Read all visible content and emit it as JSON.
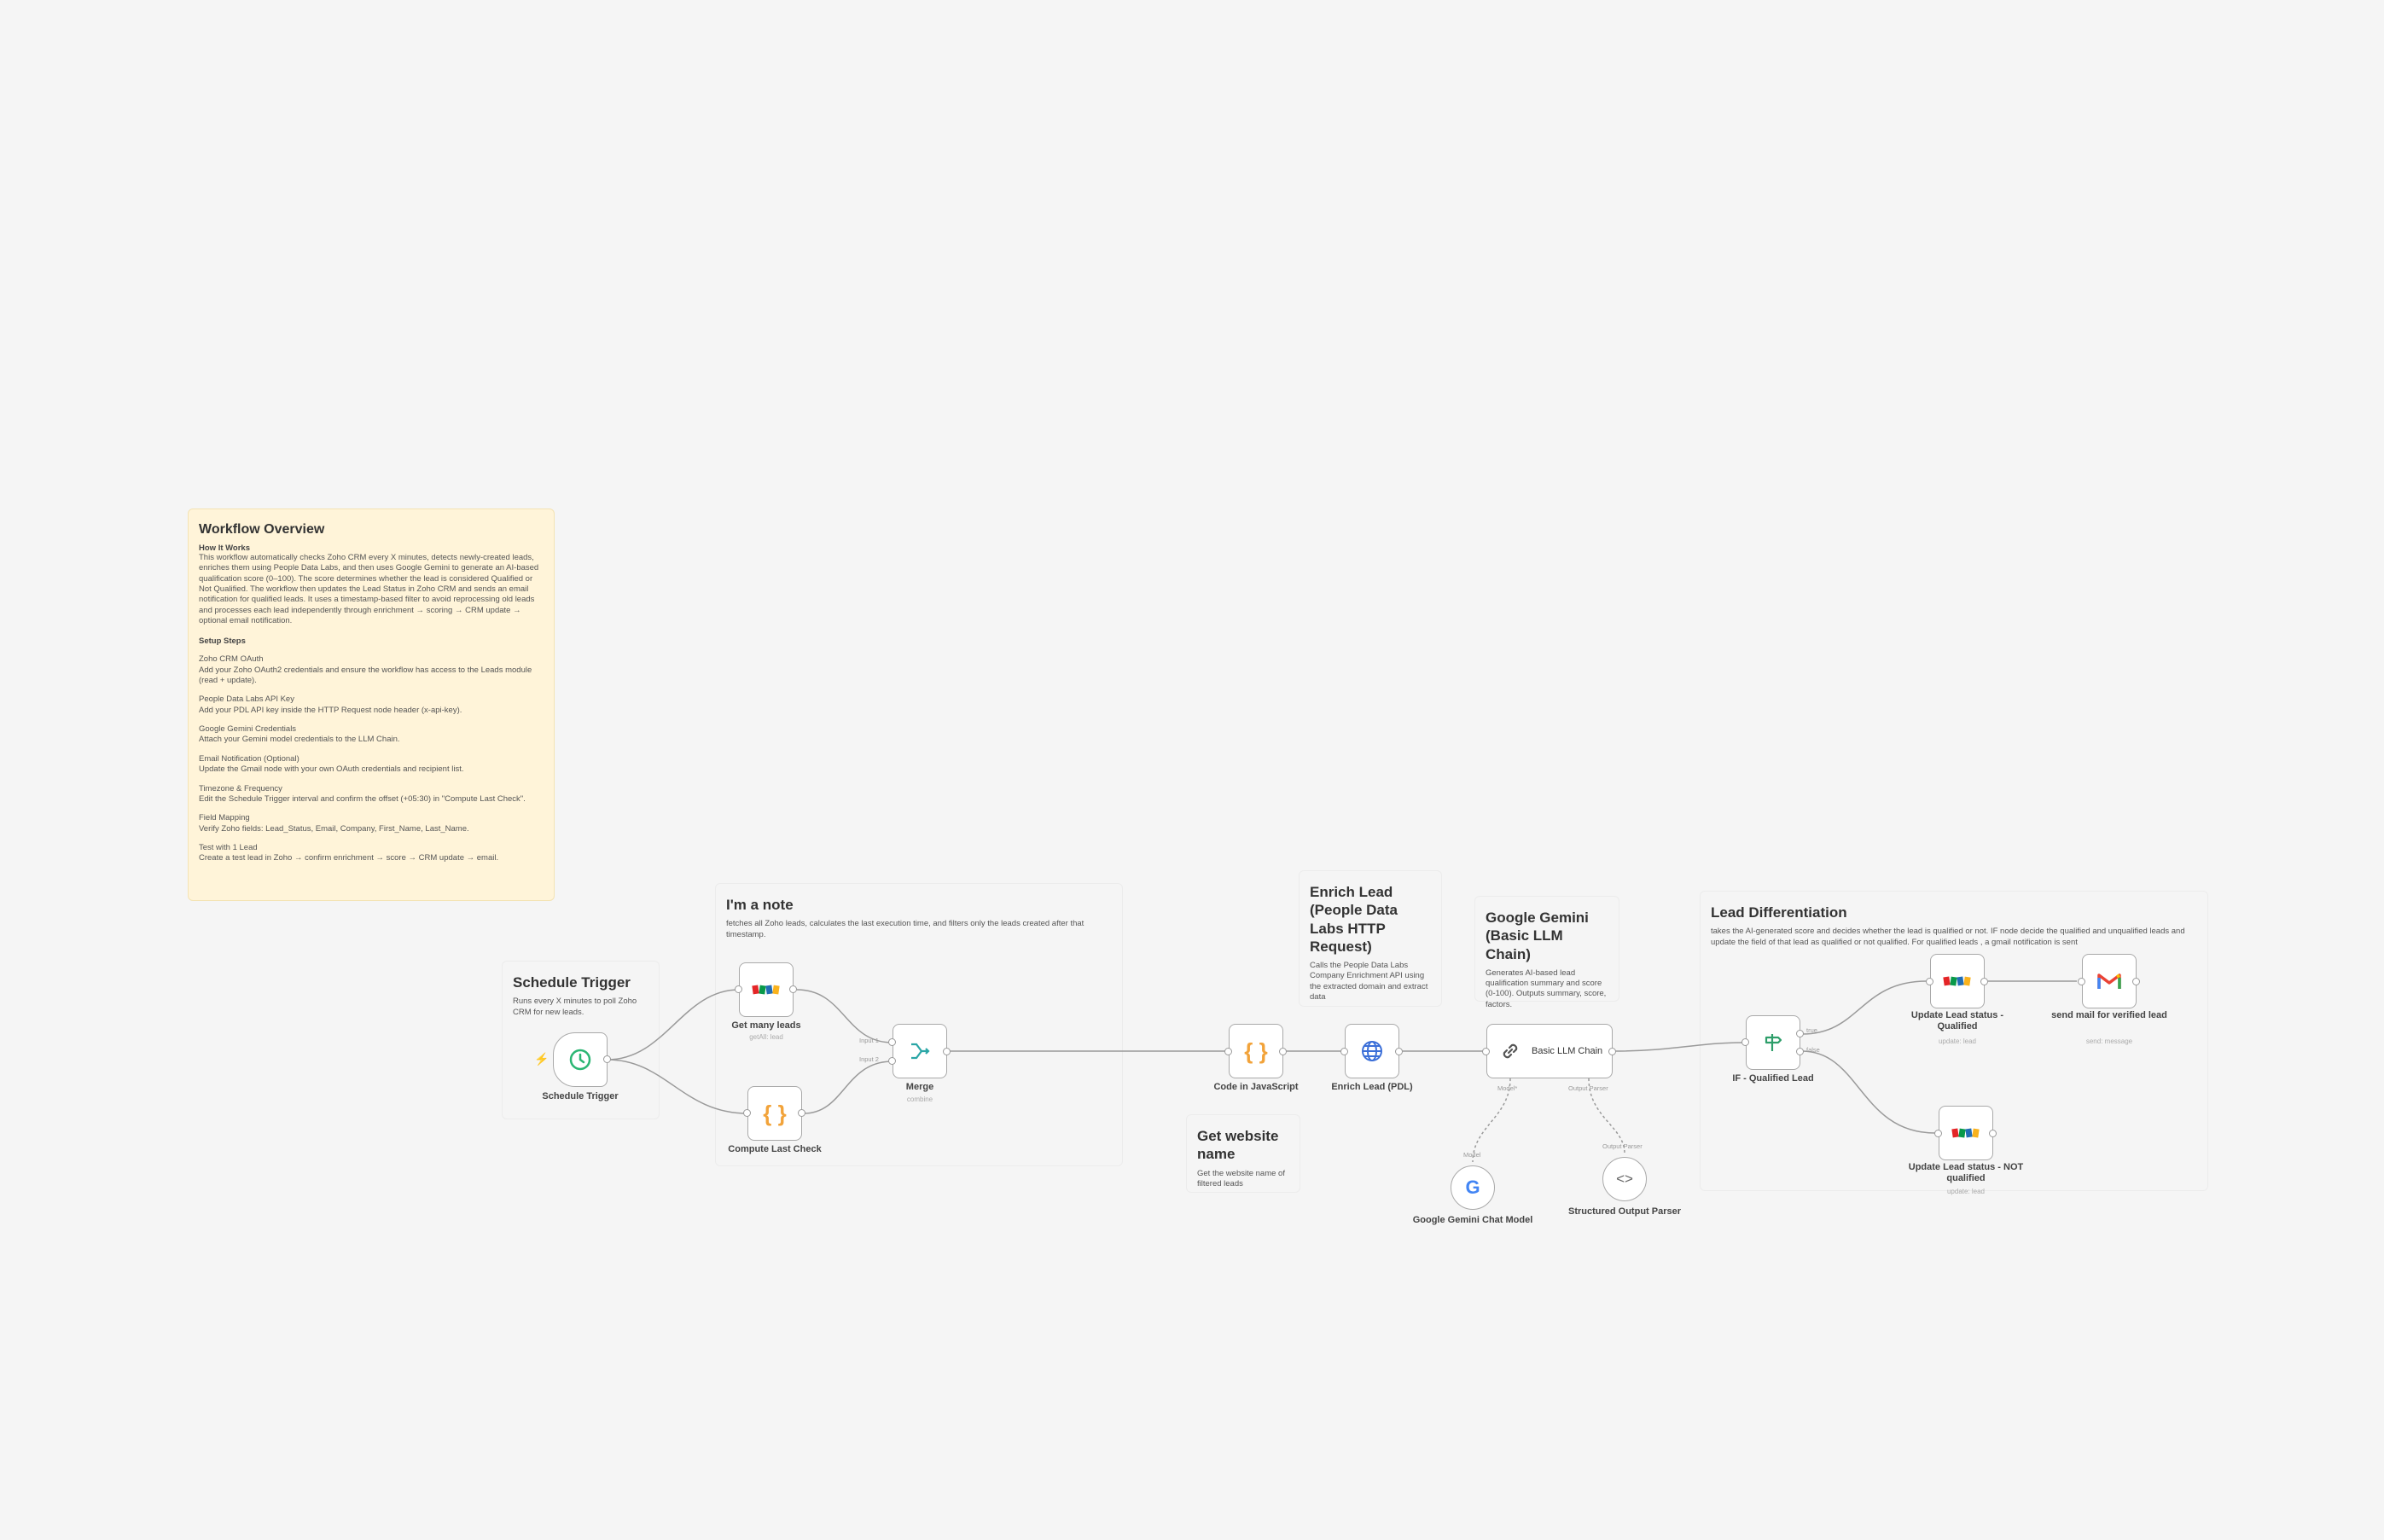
{
  "notes": {
    "overview": {
      "title": "Workflow Overview",
      "how_heading": "How It Works",
      "how_body": "This workflow automatically checks Zoho CRM every X minutes, detects newly-created leads, enriches them using People Data Labs, and then uses Google Gemini to generate an AI-based qualification score (0–100). The score determines whether the lead is considered Qualified or Not Qualified. The workflow then updates the Lead Status in Zoho CRM and sends an email notification for qualified leads. It uses a timestamp-based filter to avoid reprocessing old leads and processes each lead independently through enrichment → scoring → CRM update → optional email notification.",
      "setup_heading": "Setup Steps",
      "steps": [
        {
          "title": "Zoho CRM OAuth",
          "text": "Add your Zoho OAuth2 credentials and ensure the workflow has access to the Leads module (read + update)."
        },
        {
          "title": "People Data Labs API Key",
          "text": "Add your PDL API key inside the HTTP Request node header (x-api-key)."
        },
        {
          "title": "Google Gemini Credentials",
          "text": "Attach your Gemini model credentials to the LLM Chain."
        },
        {
          "title": "Email Notification (Optional)",
          "text": "Update the Gmail node with your own OAuth credentials and recipient list."
        },
        {
          "title": "Timezone & Frequency",
          "text": "Edit the Schedule Trigger interval and confirm the offset (+05:30) in \"Compute Last Check\"."
        },
        {
          "title": "Field Mapping",
          "text": "Verify Zoho fields: Lead_Status, Email, Company, First_Name, Last_Name."
        },
        {
          "title": "Test with 1 Lead",
          "text": "Create a test lead in Zoho → confirm enrichment → score → CRM update → email."
        }
      ]
    },
    "im_a_note": {
      "title": "I'm a note",
      "body": "fetches all Zoho leads, calculates the last execution time, and filters only the leads created after that timestamp."
    },
    "schedule_trigger": {
      "title": "Schedule Trigger",
      "body": "Runs every X minutes to poll Zoho CRM for new leads."
    },
    "enrich_lead": {
      "title": "Enrich Lead (People Data Labs HTTP Request)",
      "body": "Calls the People Data Labs Company Enrichment API using the extracted domain and extract data"
    },
    "google_gemini": {
      "title": "Google Gemini (Basic LLM Chain)",
      "body": "Generates AI-based lead qualification summary and score (0-100). Outputs summary, score, factors."
    },
    "get_website": {
      "title": "Get website name",
      "body": "Get the website name of filtered leads"
    },
    "lead_diff": {
      "title": "Lead Differentiation",
      "body": "takes the AI-generated score and decides whether the lead is qualified or not. IF node decide the qualified and unqualified leads and update the field of that lead as qualified or not qualified. For qualified leads , a gmail notification is sent"
    }
  },
  "nodes": {
    "schedule_trigger": {
      "label": "Schedule Trigger",
      "icon": "clock-icon"
    },
    "get_many_leads": {
      "label": "Get many leads",
      "sub": "getAll: lead",
      "icon": "zoho-icon"
    },
    "compute_last_check": {
      "label": "Compute Last Check",
      "icon": "code-braces-icon"
    },
    "merge": {
      "label": "Merge",
      "sub": "combine",
      "input1": "Input 1",
      "input2": "Input 2",
      "icon": "merge-icon"
    },
    "code_js": {
      "label": "Code in JavaScript",
      "icon": "code-braces-icon"
    },
    "enrich_pdl": {
      "label": "Enrich Lead (PDL)",
      "icon": "globe-icon"
    },
    "llm_chain": {
      "label": "Basic LLM Chain",
      "model_port": "Model*",
      "parser_port": "Output Parser",
      "icon": "link-icon"
    },
    "gemini_model": {
      "label": "Google Gemini Chat Model",
      "port": "Model",
      "icon": "google-icon"
    },
    "output_parser": {
      "label": "Structured Output Parser",
      "port": "Output Parser",
      "icon": "brackets-icon"
    },
    "if_qualified": {
      "label": "IF - Qualified Lead",
      "true_label": "true",
      "false_label": "false",
      "icon": "signpost-icon"
    },
    "update_qualified": {
      "label": "Update Lead status - Qualified",
      "sub": "update: lead",
      "icon": "zoho-icon"
    },
    "send_mail": {
      "label": "send mail for verified lead",
      "sub": "send: message",
      "icon": "gmail-icon"
    },
    "update_not_qualified": {
      "label": "Update Lead status - NOT qualified",
      "sub": "update: lead",
      "icon": "zoho-icon"
    }
  },
  "colors": {
    "canvas": "#f5f5f5",
    "note_yellow": "#fff4d9",
    "trigger_green": "#2bb673",
    "code_orange": "#f2a33a",
    "merge_teal": "#2aa6a6",
    "globe_blue": "#3b6fd8",
    "if_green": "#2e9e6a",
    "edge": "#9a9a9a"
  }
}
